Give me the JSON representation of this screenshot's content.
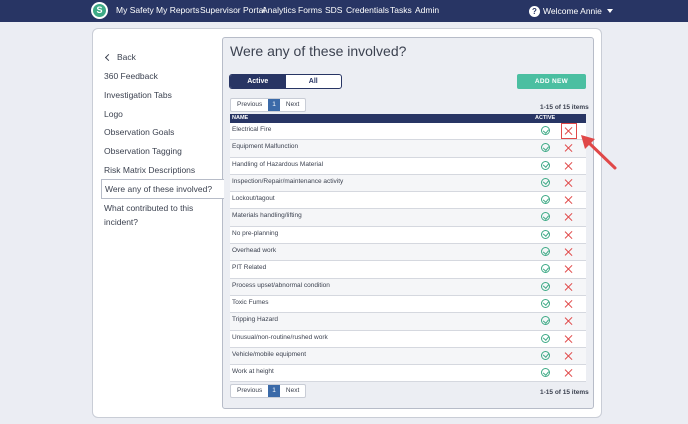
{
  "nav": {
    "logo_letter": "S",
    "links": [
      "My Safety",
      "My Reports",
      "Supervisor Portal",
      "Analytics",
      "Forms",
      "SDS",
      "Credentials",
      "Tasks",
      "Admin"
    ],
    "welcome": "Welcome Annie"
  },
  "sidebar": {
    "back": "Back",
    "items": [
      "360 Feedback",
      "Investigation Tabs",
      "Logo",
      "Observation Goals",
      "Observation Tagging",
      "Risk Matrix Descriptions"
    ],
    "active": "Were any of these involved?",
    "after": [
      "What contributed to this",
      "incident?"
    ]
  },
  "main": {
    "title": "Were any of these involved?",
    "toggle": {
      "active": "Active",
      "all": "All"
    },
    "add_new": "ADD NEW",
    "pager": {
      "prev": "Previous",
      "page": "1",
      "next": "Next"
    },
    "count": "1-15 of 15 items",
    "columns": {
      "name": "NAME",
      "active": "ACTIVE"
    },
    "rows": [
      "Electrical Fire",
      "Equipment Malfunction",
      "Handling of Hazardous Material",
      "Inspection/Repair/maintenance activity",
      "Lockout/tagout",
      "Materials handling/lifting",
      "No pre-planning",
      "Overhead work",
      "PIT Related",
      "Process upset/abnormal condition",
      "Toxic Fumes",
      "Tripping Hazard",
      "Unusual/non-routine/rushed work",
      "Vehicle/mobile equipment",
      "Work at height"
    ]
  },
  "colors": {
    "nav": "#283564",
    "accent": "#4bbfa1",
    "check": "#3eaa86",
    "delete": "#e04848"
  }
}
